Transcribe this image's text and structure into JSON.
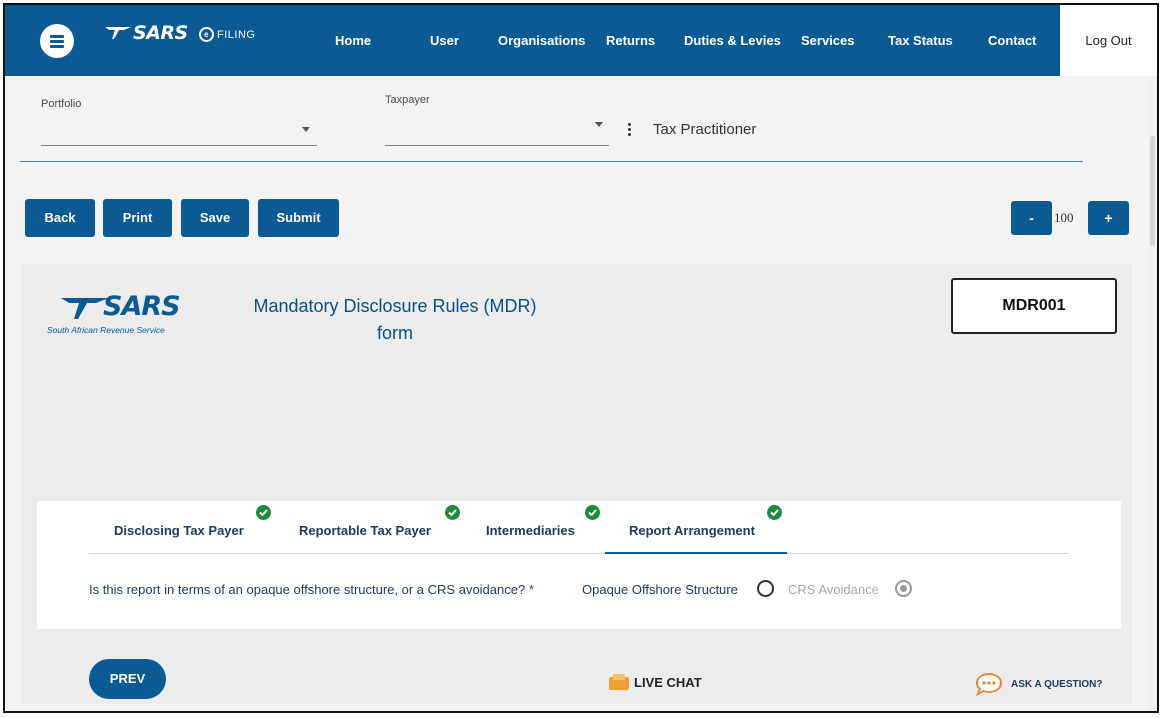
{
  "brand": {
    "logo_text": "SARS",
    "efiling_text": "FILING"
  },
  "nav": {
    "items": [
      "Home",
      "User",
      "Organisations",
      "Returns",
      "Duties & Levies",
      "Services",
      "Tax Status",
      "Contact"
    ],
    "logout": "Log Out"
  },
  "selectors": {
    "portfolio_label": "Portfolio",
    "portfolio_value": "",
    "taxpayer_label": "Taxpayer",
    "taxpayer_value": "",
    "role": "Tax Practitioner"
  },
  "toolbar": {
    "back": "Back",
    "print": "Print",
    "save": "Save",
    "submit": "Submit",
    "zoom_out": "-",
    "zoom_value": "100",
    "zoom_in": "+"
  },
  "form": {
    "logo_text": "SARS",
    "logo_subtitle": "South African Revenue Service",
    "title_line1": "Mandatory Disclosure Rules (MDR)",
    "title_line2": "form",
    "code": "MDR001"
  },
  "tabs": [
    {
      "label": "Disclosing Tax Payer",
      "complete": true
    },
    {
      "label": "Reportable Tax Payer",
      "complete": true
    },
    {
      "label": "Intermediaries",
      "complete": true
    },
    {
      "label": "Report Arrangement",
      "complete": true,
      "active": true
    }
  ],
  "question": {
    "text": "Is this report in terms of an opaque offshore structure, or a CRS avoidance? *",
    "options": [
      {
        "label": "Opaque Offshore Structure",
        "selected": false,
        "enabled": true
      },
      {
        "label": "CRS Avoidance",
        "selected": true,
        "enabled": false
      }
    ]
  },
  "footer": {
    "prev": "PREV",
    "live_chat": "LIVE CHAT",
    "ask": "ASK A QUESTION?"
  },
  "colors": {
    "primary": "#0b5a94",
    "check": "#1e8a3c",
    "chat_icon": "#f0a030",
    "ask_icon": "#e8893a"
  }
}
